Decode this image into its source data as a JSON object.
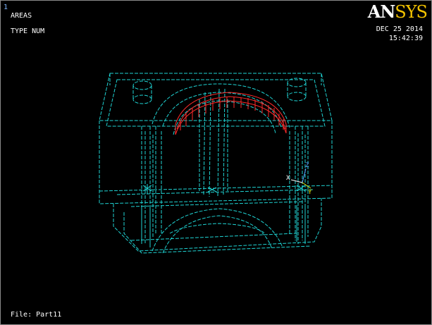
{
  "window": {
    "number": "1"
  },
  "plot": {
    "entity": "AREAS",
    "label_mode": "TYPE NUM"
  },
  "logo": {
    "part1": "AN",
    "part2": "SYS"
  },
  "timestamp": {
    "date": "DEC 25 2014",
    "time": "15:42:39"
  },
  "file": {
    "label": "File: Part11"
  },
  "triad": {
    "z": "Z",
    "x": "X",
    "y": "Y"
  },
  "colors": {
    "wireframe": "#1fd3d3",
    "selected_area": "#ff2a2a",
    "background": "#000000",
    "logo_accent": "#f2c200"
  }
}
